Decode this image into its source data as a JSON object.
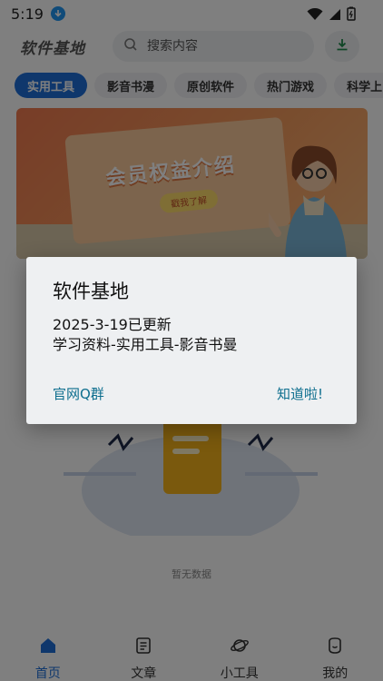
{
  "status_bar": {
    "time": "5:19"
  },
  "header": {
    "logo": "软件基地",
    "search_placeholder": "搜索内容"
  },
  "tabs": [
    {
      "label": "实用工具",
      "active": true
    },
    {
      "label": "影音书漫",
      "active": false
    },
    {
      "label": "原创软件",
      "active": false
    },
    {
      "label": "热门游戏",
      "active": false
    },
    {
      "label": "科学上",
      "active": false
    }
  ],
  "banner": {
    "title": "会员权益介绍",
    "button": "戳我了解"
  },
  "empty_state": {
    "text": "暂无数据"
  },
  "bottom_nav": [
    {
      "label": "首页",
      "icon": "home-icon",
      "active": true
    },
    {
      "label": "文章",
      "icon": "article-icon",
      "active": false
    },
    {
      "label": "小工具",
      "icon": "planet-icon",
      "active": false
    },
    {
      "label": "我的",
      "icon": "profile-icon",
      "active": false
    }
  ],
  "dialog": {
    "title": "软件基地",
    "message_line1": "2025-3-19已更新",
    "message_line2": "学习资料-实用工具-影音书曼",
    "left_button": "官网Q群",
    "right_button": "知道啦!"
  },
  "colors": {
    "accent": "#1e6fd9",
    "dialog_button": "#0d6e8e",
    "banner": "#f07a4f"
  }
}
